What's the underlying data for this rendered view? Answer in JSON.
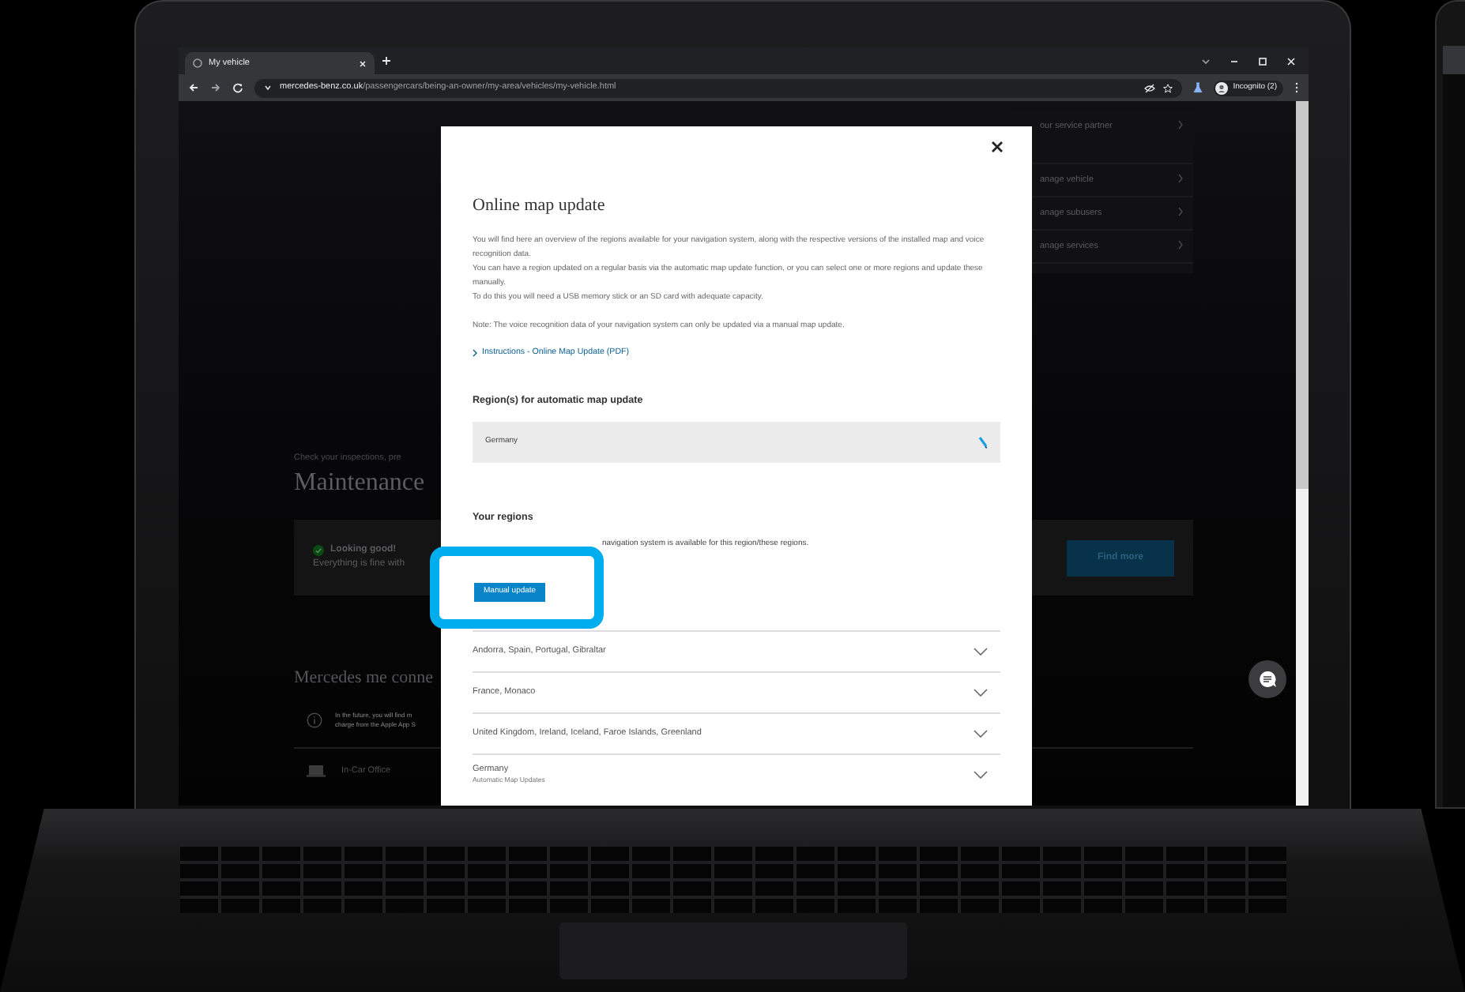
{
  "browser": {
    "tab": {
      "title": "My vehicle"
    },
    "address": {
      "domain": "mercedes-benz.co.uk",
      "path": "/passengercars/being-an-owner/my-area/vehicles/my-vehicle.html"
    },
    "profile": "Incognito (2)"
  },
  "page": {
    "side_menu": [
      {
        "label": "our service partner"
      },
      {
        "label": "anage vehicle"
      },
      {
        "label": "anage subusers"
      },
      {
        "label": "anage services"
      }
    ],
    "maintenance": {
      "intro": "Check your inspections, pre",
      "title": "Maintenance",
      "status_title": "Looking good!",
      "status_text": "Everything is fine with",
      "button": "Find more"
    },
    "connect": {
      "title": "Mercedes me conne",
      "info_lines": [
        "In the future, you will find m",
        "charge from the Apple App S"
      ],
      "feature": "In-Car Office"
    }
  },
  "modal": {
    "title": "Online map update",
    "intro_lines": [
      "You will find here an overview of the regions available for your navigation system, along with the respective versions of the installed map and voice recognition data.",
      "You can have a region updated on a regular basis via the automatic map update function, or you can select one or more regions and update these manually.",
      "To do this you will need a USB memory stick or an SD card with adequate capacity."
    ],
    "note": "Note: The voice recognition data of your navigation system can only be updated via a manual map update.",
    "link": "Instructions - Online Map Update (PDF)",
    "auto_section": {
      "heading": "Region(s) for automatic map update",
      "value": "Germany"
    },
    "regions_section": {
      "heading": "Your regions",
      "note": "navigation system is available for this region/these regions.",
      "button": "Manual update",
      "regions": [
        {
          "name": "Andorra, Spain, Portugal, Gibraltar"
        },
        {
          "name": "France, Monaco"
        },
        {
          "name": "United Kingdom, Ireland, Iceland, Faroe Islands, Greenland"
        },
        {
          "name": "Germany",
          "subtitle": "Automatic Map Updates"
        }
      ]
    }
  }
}
